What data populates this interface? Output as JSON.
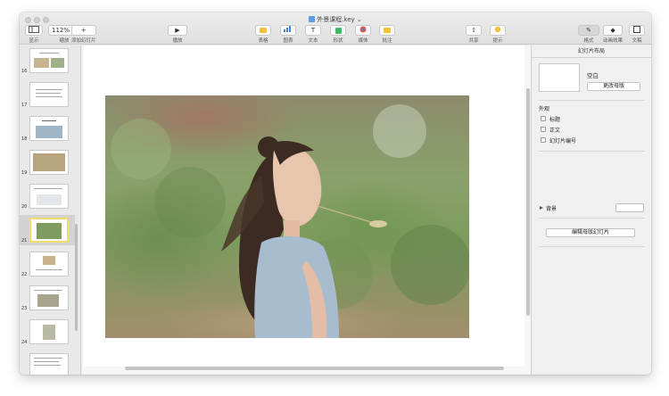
{
  "app": {
    "doc_title": "外景课程.key",
    "doc_title_chevron": "⌄"
  },
  "toolbar": {
    "view": {
      "label": "显示"
    },
    "zoom": {
      "value": "112%",
      "label": "缩放"
    },
    "add_slide": {
      "label": "添加幻灯片"
    },
    "play": {
      "label": "播放"
    },
    "table": {
      "label": "表格"
    },
    "chart": {
      "label": "图表"
    },
    "text": {
      "label": "文本"
    },
    "shape": {
      "label": "形状"
    },
    "media": {
      "label": "媒体"
    },
    "comment": {
      "label": "批注"
    },
    "share": {
      "label": "共享"
    },
    "tips": {
      "label": "提示"
    },
    "format": {
      "label": "格式"
    },
    "animate": {
      "label": "动画效果"
    },
    "document": {
      "label": "文稿"
    }
  },
  "slides": [
    {
      "number": "16",
      "selected": false
    },
    {
      "number": "17",
      "selected": false
    },
    {
      "number": "18",
      "selected": false
    },
    {
      "number": "19",
      "selected": false
    },
    {
      "number": "20",
      "selected": false
    },
    {
      "number": "21",
      "selected": true
    },
    {
      "number": "22",
      "selected": false
    },
    {
      "number": "23",
      "selected": false
    },
    {
      "number": "24",
      "selected": false
    }
  ],
  "inspector": {
    "title": "幻灯片布局",
    "layout_name": "空白",
    "change_master": "更改母版",
    "appearance_title": "外观",
    "options": [
      {
        "label": "标题",
        "checked": false
      },
      {
        "label": "正文",
        "checked": false
      },
      {
        "label": "幻灯片编号",
        "checked": false
      }
    ],
    "background_label": "背景",
    "edit_master": "编辑母版幻灯片"
  },
  "colors": {
    "accent_selection": "#f2dc6b",
    "table_icon": "#f3c13a",
    "chart_icon": "#3f86d9",
    "shape_icon": "#3dbb6b",
    "comment_icon": "#f3c13a"
  }
}
